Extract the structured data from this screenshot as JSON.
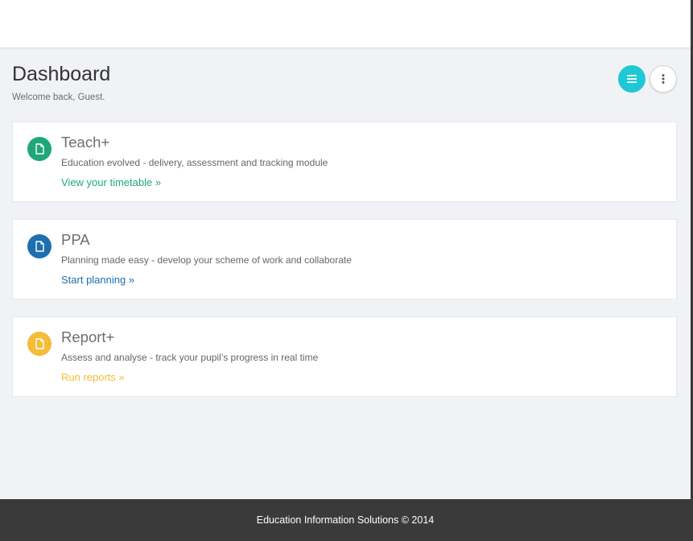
{
  "header": {
    "title": "Dashboard",
    "subtitle": "Welcome back, Guest.",
    "menu_button_icon": "hamburger-menu-icon",
    "more_button_icon": "vertical-dots-icon",
    "menu_button_color": "#1fc8d4"
  },
  "cards": [
    {
      "title": "Teach+",
      "description": "Education evolved - delivery, assessment and tracking module",
      "link": "View your timetable »",
      "icon": "document-icon",
      "color": "#1ea87a"
    },
    {
      "title": "PPA",
      "description": "Planning made easy - develop your scheme of work and collaborate",
      "link": "Start planning »",
      "icon": "document-icon",
      "color": "#1e6fb0"
    },
    {
      "title": "Report+",
      "description": "Assess and analyse - track your pupil’s progress in real time",
      "link": "Run reports »",
      "icon": "document-icon",
      "color": "#f5bc3a"
    }
  ],
  "footer": {
    "text": "Education Information Solutions © 2014"
  }
}
